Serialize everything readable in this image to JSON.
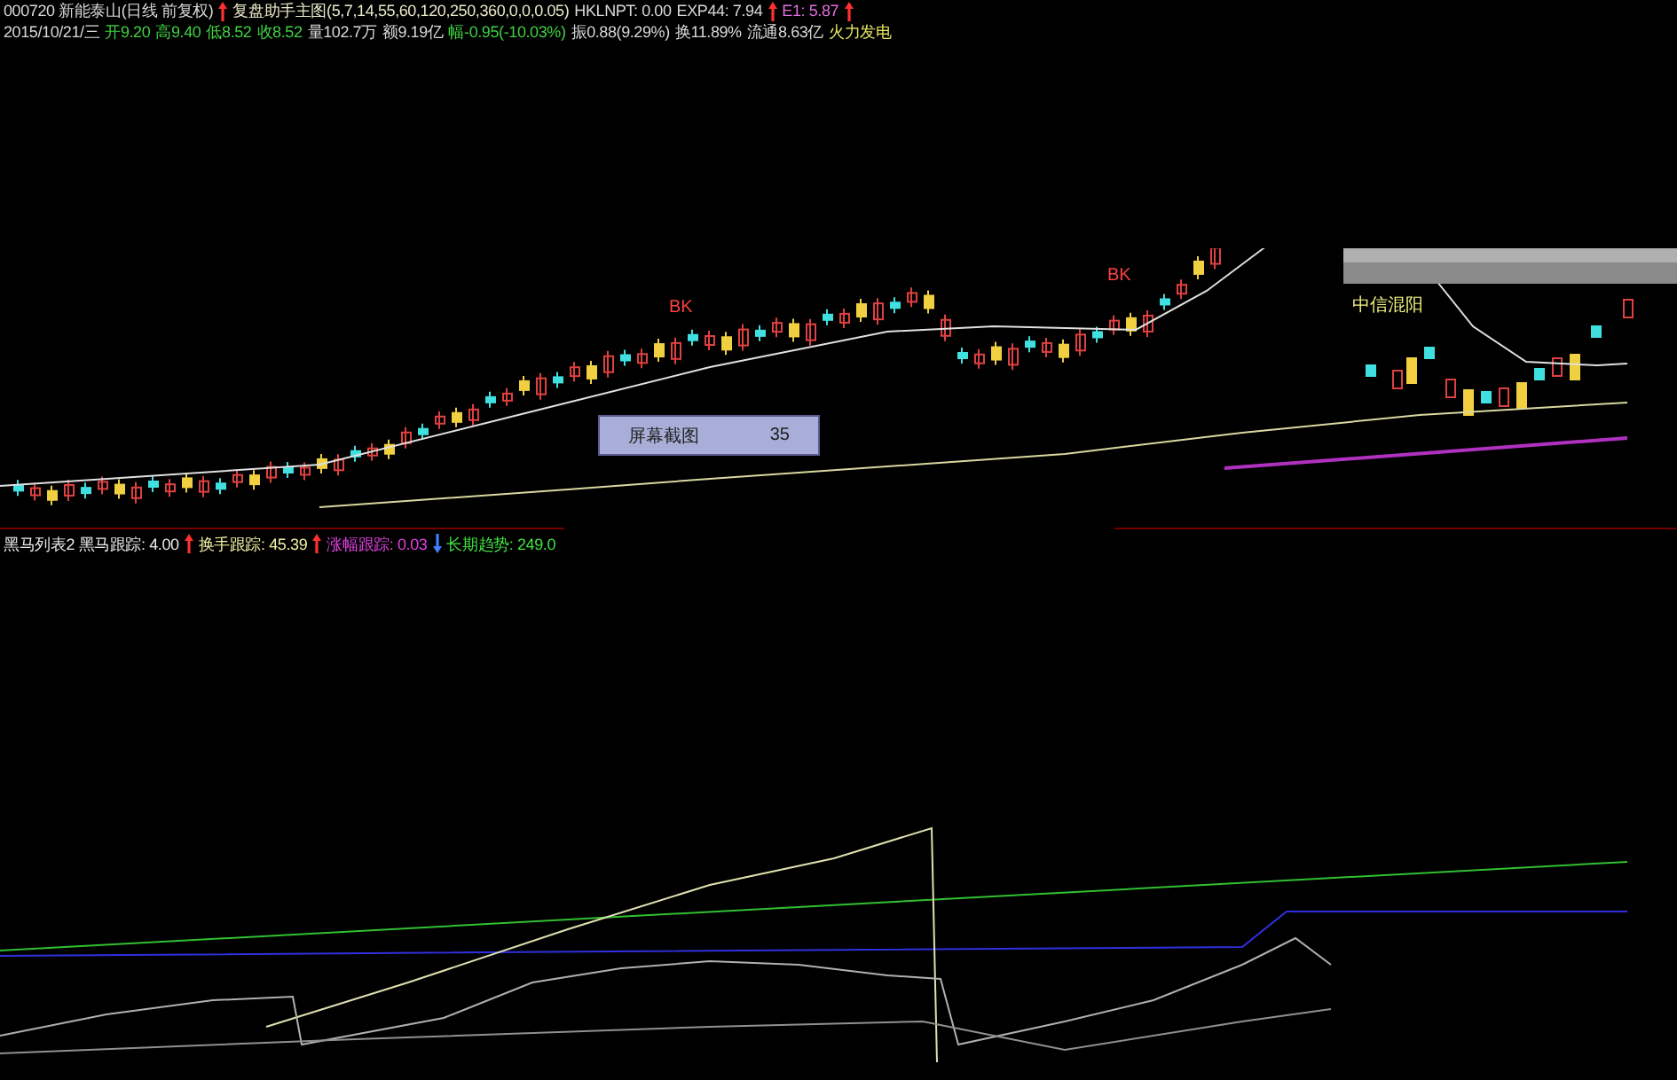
{
  "header_line1": [
    {
      "kind": "text",
      "text": "000720 新能泰山(日线 前复权)",
      "color": "#d8d8d8"
    },
    {
      "kind": "arrow-up",
      "color": "#ff3030"
    },
    {
      "kind": "text",
      "text": "复盘助手主图(5,7,14,55,60,120,250,360,0,0,0.05)",
      "color": "#e8e8c8"
    },
    {
      "kind": "text",
      "text": "HKLNPT: 0.00",
      "color": "#d8d8d8"
    },
    {
      "kind": "text",
      "text": "EXP44: 7.94",
      "color": "#d8d8d8"
    },
    {
      "kind": "arrow-up",
      "color": "#ff3030"
    },
    {
      "kind": "text",
      "text": "E1: 5.87",
      "color": "#e070e0"
    },
    {
      "kind": "arrow-up",
      "color": "#ff3030"
    }
  ],
  "header_line2": [
    {
      "text": "2015/10/21/三",
      "color": "#d8d8d8"
    },
    {
      "text": "开9.20",
      "color": "#40d040"
    },
    {
      "text": "高9.40",
      "color": "#40d040"
    },
    {
      "text": "低8.52",
      "color": "#40d040"
    },
    {
      "text": "收8.52",
      "color": "#40d040"
    },
    {
      "text": "量102.7万",
      "color": "#d8d8d8"
    },
    {
      "text": "额9.19亿",
      "color": "#d8d8d8"
    },
    {
      "text": "幅-0.95(-10.03%)",
      "color": "#40d040"
    },
    {
      "text": "振0.88(9.29%)",
      "color": "#d8d8d8"
    },
    {
      "text": "换11.89%",
      "color": "#d8d8d8"
    },
    {
      "text": "流通8.63亿",
      "color": "#d8d8d8"
    },
    {
      "text": "火力发电",
      "color": "#e8e860"
    }
  ],
  "chart_labels": [
    {
      "text": "BK",
      "color": "#ff4040"
    },
    {
      "text": "BK",
      "color": "#ff4040"
    },
    {
      "text": "中信混阳",
      "color": "#f0f080"
    }
  ],
  "popup": {
    "label": "屏幕截图",
    "value": "35"
  },
  "indicator_header": [
    {
      "text": "黑马列表2 黑马跟踪: 4.00",
      "color": "#e8e8e8",
      "kind": "arrow-up"
    },
    {
      "text": "换手跟踪: 45.39",
      "color": "#f0f0a0",
      "kind": "arrow-up"
    },
    {
      "text": "涨幅跟踪: 0.03",
      "color": "#e040e0",
      "kind": "arrow-down"
    },
    {
      "text": "长期趋势: 249.0",
      "color": "#40e040",
      "kind": "none"
    }
  ]
}
